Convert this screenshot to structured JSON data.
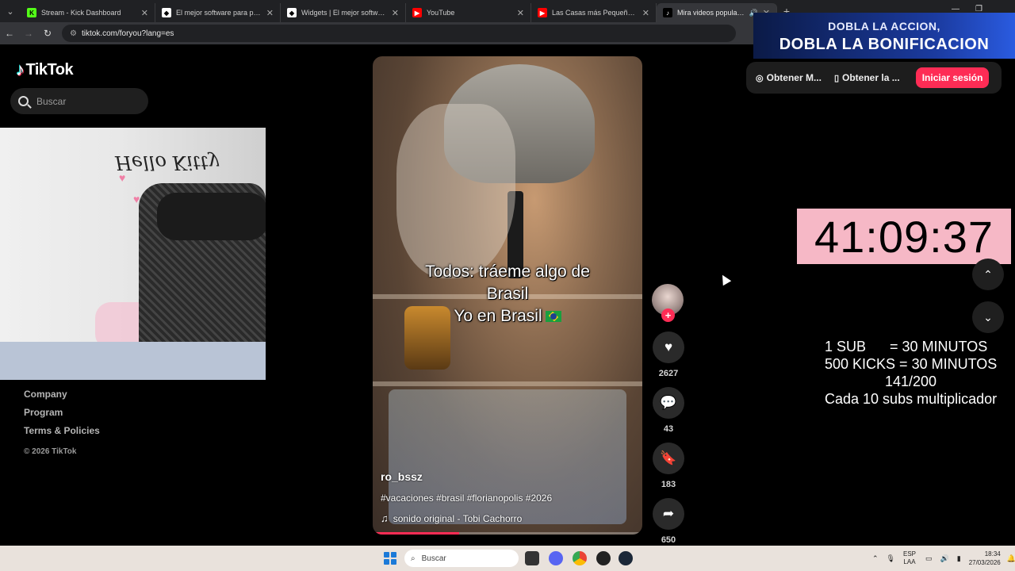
{
  "browser": {
    "tabs": [
      {
        "title": "Stream - Kick Dashboard",
        "favicon": "kick-icon",
        "color": "#53fc18"
      },
      {
        "title": "El mejor software para potenciar",
        "favicon": "streamelements-icon",
        "color": "#ffffff"
      },
      {
        "title": "Widgets | El mejor software para",
        "favicon": "streamelements-icon",
        "color": "#ffffff"
      },
      {
        "title": "YouTube",
        "favicon": "youtube-icon",
        "color": "#ff0000"
      },
      {
        "title": "Las Casas más Pequeñas del M",
        "favicon": "youtube-icon",
        "color": "#ff0000"
      },
      {
        "title": "Mira videos populares selec",
        "favicon": "tiktok-icon",
        "color": "#ffffff",
        "active": true
      }
    ],
    "new_tab": "+",
    "url": "tiktok.com/foryou?lang=es"
  },
  "tiktok": {
    "logo": "TikTok",
    "search_placeholder": "Buscar",
    "footer": {
      "links": [
        "Company",
        "Program",
        "Terms & Policies"
      ],
      "copyright": "© 2026 TikTok"
    },
    "header": {
      "get_coins": "Obtener M...",
      "get_app": "Obtener la ...",
      "login": "Iniciar sesión"
    },
    "video": {
      "caption_lines": [
        "Todos: tráeme algo de",
        "Brasil",
        "Yo en Brasil"
      ],
      "author": "ro_bssz",
      "hashtags": "#vacaciones #brasil #florianopolis #2026",
      "sound": "sonido original - Tobi Cachorro",
      "progress": 0.32
    },
    "actions": {
      "likes": "2627",
      "comments": "43",
      "saves": "183",
      "shares": "650"
    }
  },
  "overlay": {
    "webcam_wall_text": "Hello Kitty",
    "promo_line1": "DOBLA LA ACCION,",
    "promo_line2": "DOBLA LA BONIFICACION",
    "timer": "41:09:37",
    "rules": [
      "1 SUB      = 30 MINUTOS",
      "500 KICKS = 30 MINUTOS",
      "141/200",
      "Cada 10 subs multiplicador"
    ]
  },
  "taskbar": {
    "search_placeholder": "Buscar",
    "lang_line1": "ESP",
    "lang_line2": "LAA",
    "time": "18:34",
    "date": "27/03/2026"
  },
  "colors": {
    "accent": "#fe2c55",
    "timer_bg": "#f6b8c6"
  }
}
